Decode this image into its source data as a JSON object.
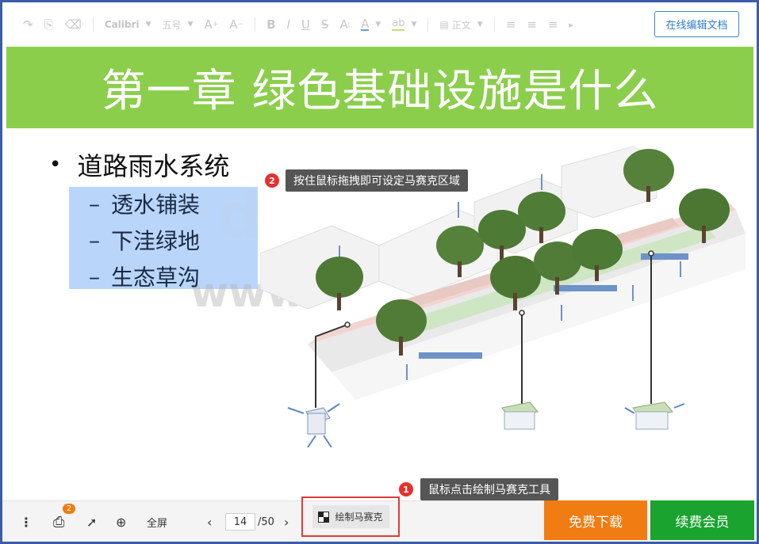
{
  "toolbar": {
    "font_name": "Calibri",
    "font_size": "五号",
    "paragraph_style": "正文",
    "edit_online_label": "在线编辑文档"
  },
  "slide": {
    "title": "第一章 绿色基础设施是什么",
    "main_bullet": "道路雨水系统",
    "sub_bullets": [
      "透水铺装",
      "下洼绿地",
      "生态草沟"
    ],
    "watermark": "www"
  },
  "tooltips": {
    "step1": {
      "number": "1",
      "text": "鼠标点击绘制马赛克工具"
    },
    "step2": {
      "number": "2",
      "text": "按住鼠标拖拽即可设定马赛克区域"
    }
  },
  "bottom_bar": {
    "print_badge_count": "2",
    "fullscreen_label": "全屏",
    "current_page": "14",
    "total_pages": "/50",
    "mosaic_label": "绘制马赛克",
    "download_label": "免费下载",
    "vip_label": "续费会员"
  },
  "colors": {
    "title_band": "#8bce4b",
    "download": "#f07c12",
    "vip": "#1aa32f",
    "highlight_border": "#e53935",
    "selection": "#b9d6fa"
  }
}
